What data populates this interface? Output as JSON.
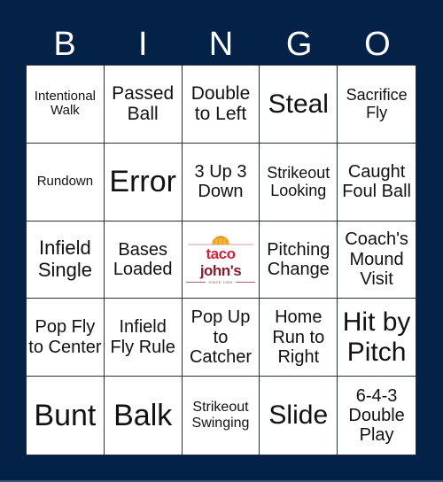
{
  "header": {
    "letters": [
      "B",
      "I",
      "N",
      "G",
      "O"
    ]
  },
  "colors": {
    "background": "#042248",
    "grid_line": "#2a2f36",
    "brand_red": "#d71f36",
    "brand_maroon": "#8a1b2e"
  },
  "cells": [
    [
      "Intentional Walk",
      "Passed Ball",
      "Double to Left",
      "Steal",
      "Sacrifice Fly"
    ],
    [
      "Rundown",
      "Error",
      "3 Up 3 Down",
      "Strikeout Looking",
      "Caught Foul Ball"
    ],
    [
      "Infield Single",
      "Bases Loaded",
      "FREE",
      "Pitching Change",
      "Coach's Mound Visit"
    ],
    [
      "Pop Fly to Center",
      "Infield Fly Rule",
      "Pop Up to Catcher",
      "Home Run to Right",
      "Hit by Pitch"
    ],
    [
      "Bunt",
      "Balk",
      "Strikeout Swinging",
      "Slide",
      "6-4-3 Double Play"
    ]
  ],
  "free_space": {
    "logo_icon": "taco-icon",
    "brand_part1": "taco",
    "brand_part2": "john's",
    "tagline": "SINCE 1969"
  }
}
